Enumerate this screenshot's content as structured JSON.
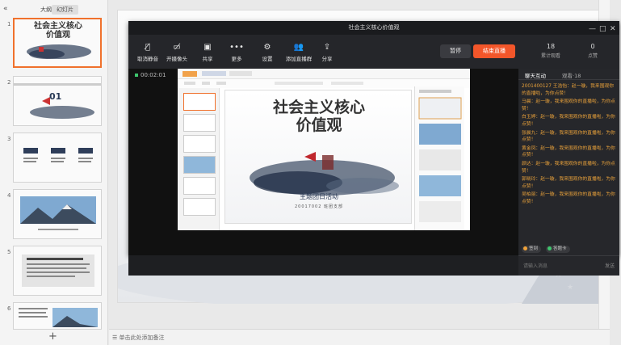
{
  "left_panel": {
    "collapse_icon": "double-chevron-left-icon",
    "tabs": [
      {
        "label": "大纲",
        "active": false
      },
      {
        "label": "幻灯片",
        "active": true
      }
    ],
    "slides": [
      {
        "num": "1",
        "title": "社会主义核心\n价值观",
        "selected": true
      },
      {
        "num": "2",
        "title": "01",
        "selected": false
      },
      {
        "num": "3",
        "title": "",
        "selected": false
      },
      {
        "num": "4",
        "title": "",
        "selected": false
      },
      {
        "num": "5",
        "title": "",
        "selected": false
      },
      {
        "num": "6",
        "title": "",
        "selected": false
      }
    ],
    "add_label": "+"
  },
  "notes": {
    "placeholder": "单击此处添加备注",
    "icon": "notes-icon"
  },
  "live": {
    "title": "社会主义核心价值观",
    "window_controls": [
      "—",
      "□",
      "✕"
    ],
    "toolbar": [
      {
        "label": "取消静音",
        "icon": "mic-off-icon"
      },
      {
        "label": "开摄像头",
        "icon": "camera-off-icon"
      },
      {
        "label": "共享",
        "icon": "share-screen-icon"
      },
      {
        "label": "更多",
        "icon": "more-icon"
      },
      {
        "label": "设置",
        "icon": "gear-icon"
      },
      {
        "label": "添加直播群",
        "icon": "add-group-icon"
      },
      {
        "label": "分享",
        "icon": "share-icon"
      }
    ],
    "pause_label": "暂停",
    "end_label": "结束直播",
    "stats": [
      {
        "value": "18",
        "label": "累计观看"
      },
      {
        "value": "0",
        "label": "点赞"
      }
    ],
    "timer": "00:02:01",
    "screen": {
      "slide_title": "社会主义核心\n价值观",
      "slide_subtitle": "主题团日活动",
      "slide_date": "20017002 班团支部"
    },
    "chat": {
      "tabs": [
        {
          "label": "聊天互动",
          "active": true
        },
        {
          "label": "观看·18",
          "active": false
        }
      ],
      "messages": [
        "2001400127 王浩怡：赵一璇，我来围观你的直播啦，为你点赞！",
        "马晨：赵一璇，我来围观你的直播啦，为你点赞！",
        "白玉婷：赵一璇，我来围观你的直播啦，为你点赞！",
        "张晨九：赵一璇，我来围观你的直播啦，为你点赞！",
        "黄金凤：赵一璇，我来围观你的直播啦，为你点赞！",
        "颜达：赵一璇，我来围观你的直播啦，为你点赞！",
        "郭晓玲：赵一璇，我来围观你的直播啦，为你点赞！",
        "吴柏丽：赵一璇，我来围观你的直播啦，为你点赞！"
      ],
      "chips": [
        {
          "label": "签到",
          "color": "#f0a23a"
        },
        {
          "label": "答题卡",
          "color": "#3ec76e"
        }
      ],
      "input_placeholder": "请输入消息",
      "send_label": "发送"
    }
  }
}
